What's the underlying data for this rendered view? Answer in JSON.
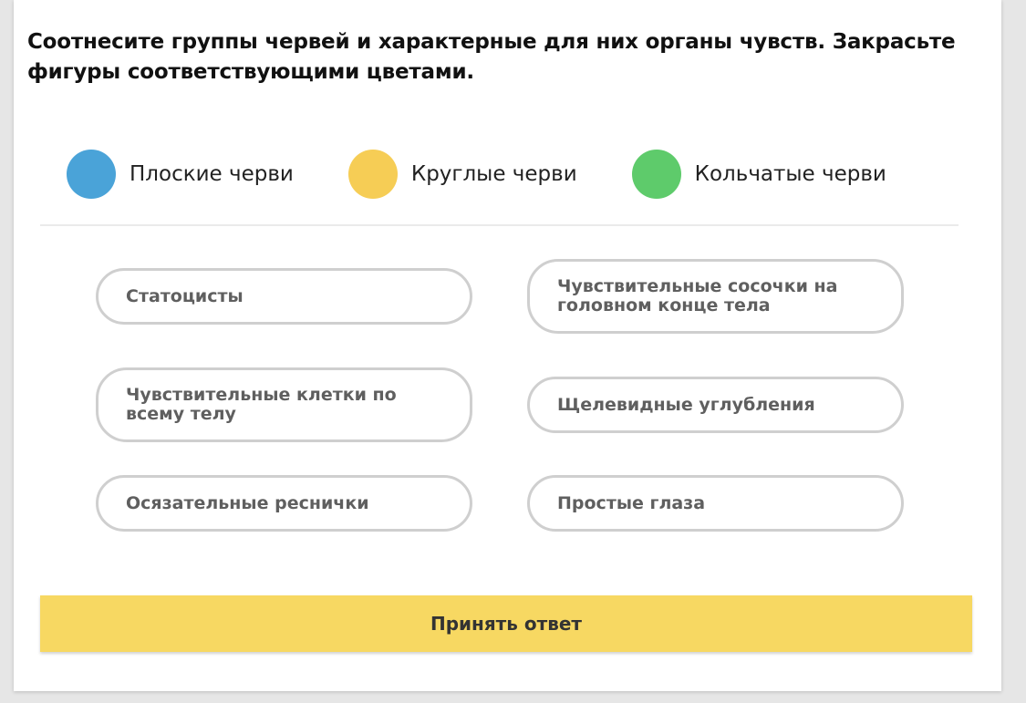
{
  "question": "Соотнесите группы червей и характерные для них органы чувств. Закрасьте фигуры соответствующими цветами.",
  "legend": [
    {
      "label": "Плоские черви",
      "color": "#4aa3d8"
    },
    {
      "label": "Круглые черви",
      "color": "#f6cd55"
    },
    {
      "label": "Кольчатые черви",
      "color": "#5ecb6b"
    }
  ],
  "options": [
    {
      "label": "Статоцисты"
    },
    {
      "label": "Чувствительные сосочки на головном конце тела"
    },
    {
      "label": "Чувствительные клетки по всему телу"
    },
    {
      "label": "Щелевидные углубления"
    },
    {
      "label": "Осязательные реснички"
    },
    {
      "label": "Простые глаза"
    }
  ],
  "submit_label": "Принять ответ",
  "colors": {
    "pill_border": "#cfcfcf",
    "submit_background": "#f7d862"
  }
}
